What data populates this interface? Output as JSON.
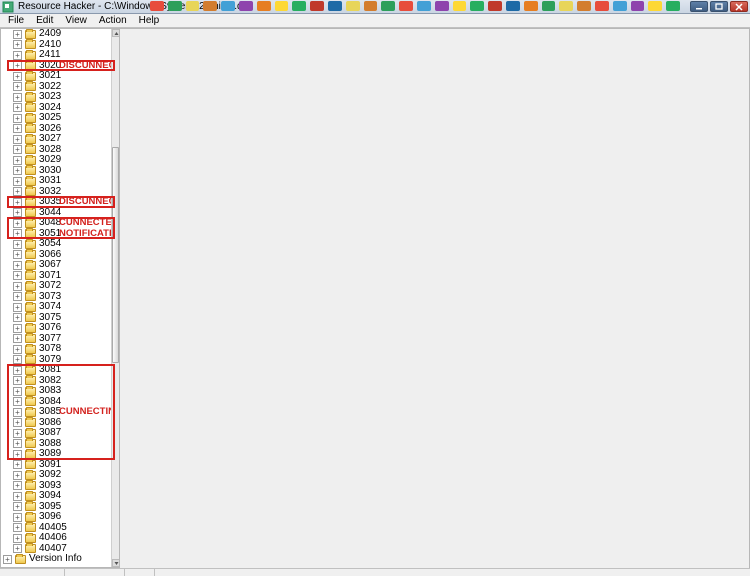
{
  "window": {
    "app_name": "Resource Hacker",
    "title_sep": "  -  ",
    "file_path": "C:\\Windows\\System32\\pnidui.dll"
  },
  "menu": {
    "items": [
      {
        "id": "file",
        "label": "File"
      },
      {
        "id": "edit",
        "label": "Edit"
      },
      {
        "id": "view",
        "label": "View"
      },
      {
        "id": "action",
        "label": "Action"
      },
      {
        "id": "help",
        "label": "Help"
      }
    ]
  },
  "taskstrip": {
    "colors": [
      "#e74c3c",
      "#2d9f5b",
      "#e8d559",
      "#d37d2e",
      "#42a0d6",
      "#8e44ad",
      "#e67e22",
      "#fdd835",
      "#27ae60",
      "#c0392b",
      "#1e6aa6",
      "#e8d559",
      "#d37d2e",
      "#2d9f5b",
      "#e74c3c",
      "#42a0d6",
      "#8e44ad",
      "#fdd835",
      "#27ae60",
      "#c0392b",
      "#1e6aa6",
      "#e67e22",
      "#2d9f5b",
      "#e8d559",
      "#d37d2e",
      "#e74c3c",
      "#42a0d6",
      "#8e44ad",
      "#fdd835",
      "#27ae60"
    ]
  },
  "tree": {
    "nodes": [
      {
        "id": "2409",
        "level": 1
      },
      {
        "id": "2410",
        "level": 1
      },
      {
        "id": "2411",
        "level": 1
      },
      {
        "id": "3020",
        "level": 1,
        "annotation": "DISCUNNECTED",
        "highlight_group": 0
      },
      {
        "id": "3021",
        "level": 1
      },
      {
        "id": "3022",
        "level": 1
      },
      {
        "id": "3023",
        "level": 1
      },
      {
        "id": "3024",
        "level": 1
      },
      {
        "id": "3025",
        "level": 1
      },
      {
        "id": "3026",
        "level": 1
      },
      {
        "id": "3027",
        "level": 1
      },
      {
        "id": "3028",
        "level": 1
      },
      {
        "id": "3029",
        "level": 1
      },
      {
        "id": "3030",
        "level": 1
      },
      {
        "id": "3031",
        "level": 1
      },
      {
        "id": "3032",
        "level": 1
      },
      {
        "id": "3035",
        "level": 1,
        "annotation": "DISCUNNECTED",
        "highlight_group": 1
      },
      {
        "id": "3044",
        "level": 1
      },
      {
        "id": "3048",
        "level": 1,
        "annotation": "CUNNECTED",
        "highlight_group": 2
      },
      {
        "id": "3051",
        "level": 1,
        "annotation": "NOTIFICATION",
        "highlight_group": 2
      },
      {
        "id": "3054",
        "level": 1
      },
      {
        "id": "3066",
        "level": 1
      },
      {
        "id": "3067",
        "level": 1
      },
      {
        "id": "3071",
        "level": 1
      },
      {
        "id": "3072",
        "level": 1
      },
      {
        "id": "3073",
        "level": 1
      },
      {
        "id": "3074",
        "level": 1
      },
      {
        "id": "3075",
        "level": 1
      },
      {
        "id": "3076",
        "level": 1
      },
      {
        "id": "3077",
        "level": 1
      },
      {
        "id": "3078",
        "level": 1
      },
      {
        "id": "3079",
        "level": 1
      },
      {
        "id": "3081",
        "level": 1,
        "highlight_group": 3
      },
      {
        "id": "3082",
        "level": 1,
        "highlight_group": 3
      },
      {
        "id": "3083",
        "level": 1,
        "highlight_group": 3
      },
      {
        "id": "3084",
        "level": 1,
        "highlight_group": 3
      },
      {
        "id": "3085",
        "level": 1,
        "annotation": "CUNNECTING",
        "highlight_group": 3
      },
      {
        "id": "3086",
        "level": 1,
        "highlight_group": 3
      },
      {
        "id": "3087",
        "level": 1,
        "highlight_group": 3
      },
      {
        "id": "3088",
        "level": 1,
        "highlight_group": 3
      },
      {
        "id": "3089",
        "level": 1,
        "highlight_group": 3
      },
      {
        "id": "3091",
        "level": 1
      },
      {
        "id": "3092",
        "level": 1
      },
      {
        "id": "3093",
        "level": 1
      },
      {
        "id": "3094",
        "level": 1
      },
      {
        "id": "3095",
        "level": 1
      },
      {
        "id": "3096",
        "level": 1
      },
      {
        "id": "40405",
        "level": 1
      },
      {
        "id": "40406",
        "level": 1
      },
      {
        "id": "40407",
        "level": 1
      },
      {
        "id": "Version Info",
        "level": 0
      }
    ]
  },
  "scrollbar": {
    "thumb_top_pct": 22,
    "thumb_height_pct": 40
  }
}
